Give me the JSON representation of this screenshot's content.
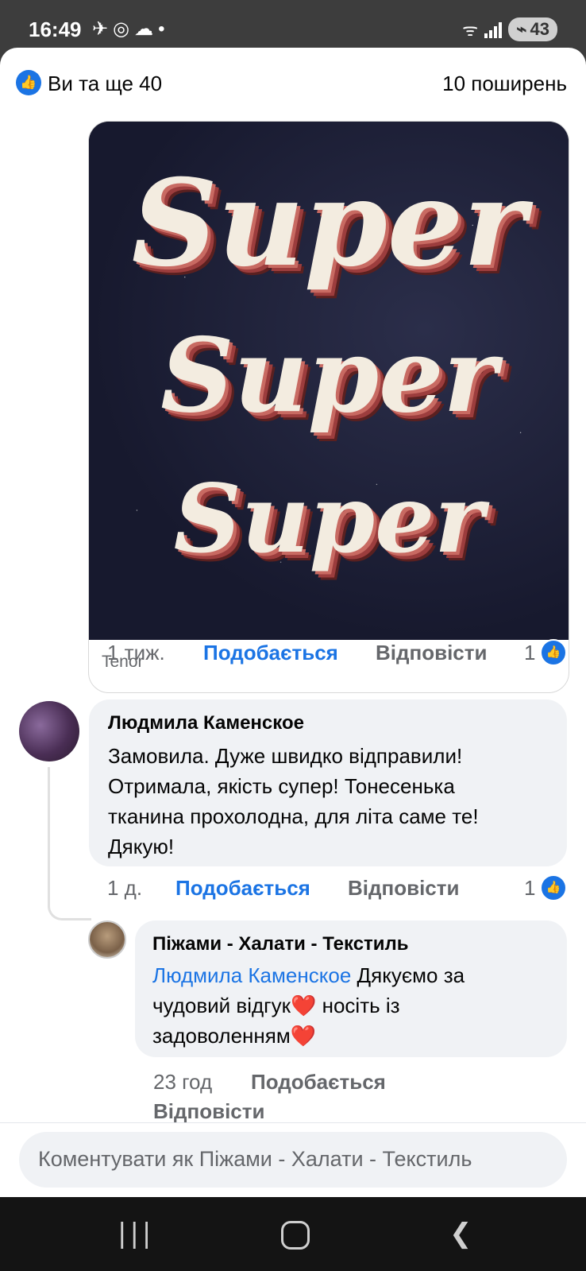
{
  "status_bar": {
    "time": "16:49",
    "icons": [
      "telegram-icon",
      "instagram-icon",
      "messenger-icon",
      "dot-icon"
    ],
    "battery": "43"
  },
  "header": {
    "likes_text": "Ви та ще 40",
    "shares_text": "10 поширень"
  },
  "gif_comment": {
    "gif_words": [
      "Super",
      "Super",
      "Super"
    ],
    "source": "Tenor",
    "time": "1 тиж.",
    "like_label": "Подобається",
    "reply_label": "Відповісти",
    "reaction_count": "1"
  },
  "comment1": {
    "author": "Людмила Каменское",
    "text_lines": [
      "Замовила. Дуже швидко відправили!",
      "Отримала, якість супер! Тонесенька",
      "тканина прохолодна, для літа саме те!",
      "Дякую!"
    ],
    "time": "1 д.",
    "like_label": "Подобається",
    "reply_label": "Відповісти",
    "reaction_count": "1"
  },
  "reply1": {
    "author": "Піжами - Халати - Текстиль",
    "mention": "Людмила Каменское",
    "text_line1_rest": " Дякуємо за",
    "text_line2": "чудовий відгук❤️ носіть із",
    "text_line3": "задоволенням❤️",
    "time": "23 год",
    "like_label": "Подобається",
    "reply_label": "Відповісти"
  },
  "composer": {
    "placeholder": "Коментувати як Піжами - Халати - Текстиль"
  },
  "nav_bar": {
    "buttons": [
      "recent-apps",
      "home",
      "back"
    ]
  },
  "colors": {
    "accent": "#1b74e4",
    "bubble": "#f0f2f5",
    "secondary_text": "#65676b"
  }
}
